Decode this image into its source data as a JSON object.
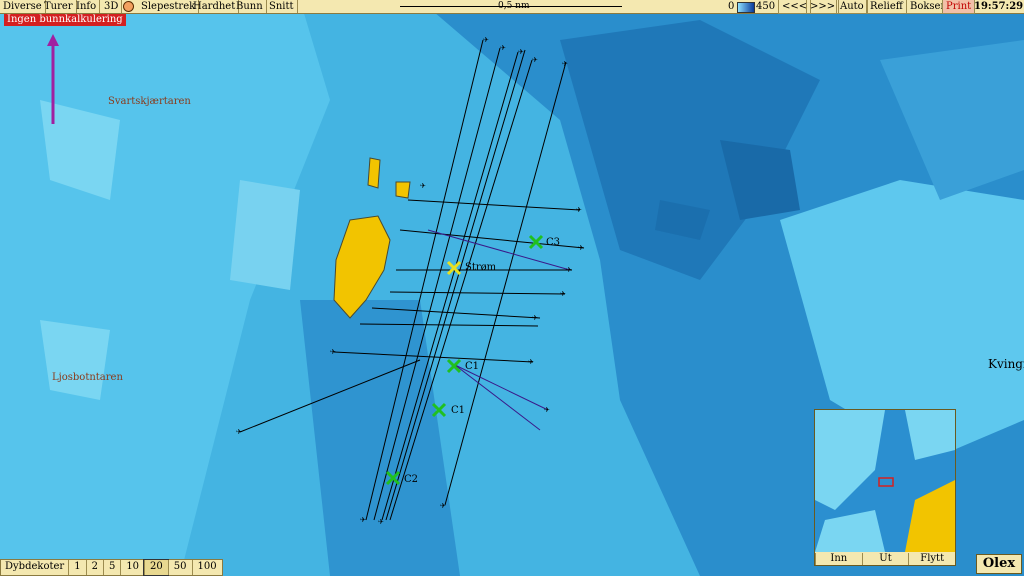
{
  "toolbar": {
    "items": [
      "Diverse",
      "Turer",
      "Info",
      "3D",
      "Slepestrek",
      "Hardhet",
      "Bunn",
      "Snitt"
    ],
    "scale": "0,5 nm",
    "depth_min": "0",
    "depth_max": "450",
    "buttons": [
      "<<<",
      ">>>",
      "Auto",
      "Relieff",
      "Bokser"
    ],
    "print": "Print",
    "time": "19:57:29"
  },
  "warning": "Ingen bunnkalkulering",
  "places": {
    "svartskjaertaren": "Svartskjærtaren",
    "ljosbotntaren": "Ljosbotntaren",
    "kvingr": "Kvingr"
  },
  "markers": [
    "Strøm",
    "C1",
    "C1",
    "C2",
    "C3"
  ],
  "depth_bar": {
    "label": "Dybdekoter",
    "options": [
      "1",
      "2",
      "5",
      "10",
      "20",
      "50",
      "100"
    ],
    "selected": "20"
  },
  "minimap": {
    "buttons": [
      "Inn",
      "Ut",
      "Flytt"
    ]
  },
  "brand": "Olex",
  "colors": {
    "land": "#f2c400",
    "track": "#000000",
    "route": "#3a1a8a",
    "marker_green": "#20c020",
    "marker_yellow": "#e8e020"
  }
}
